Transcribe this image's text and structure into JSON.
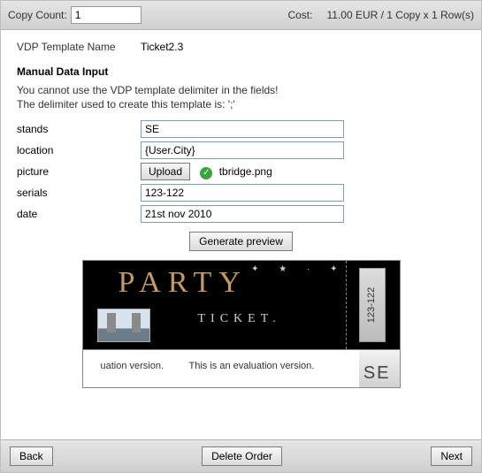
{
  "topbar": {
    "copy_label": "Copy Count:",
    "copy_value": "1",
    "cost_label": "Cost:",
    "cost_value": "11.00 EUR / 1 Copy x 1 Row(s)"
  },
  "template": {
    "name_label": "VDP Template Name",
    "name_value": "Ticket2.3"
  },
  "section_title": "Manual Data Input",
  "note_line1": "You cannot use the VDP template delimiter in the fields!",
  "note_line2": "The delimiter used to create this template is: ';'",
  "fields": {
    "stands": {
      "label": "stands",
      "value": "SE"
    },
    "location": {
      "label": "location",
      "value": "{User.City}"
    },
    "picture": {
      "label": "picture",
      "upload": "Upload",
      "file": "tbridge.png"
    },
    "serials": {
      "label": "serials",
      "value": "123-122"
    },
    "date": {
      "label": "date",
      "value": "21st nov 2010"
    }
  },
  "generate": "Generate preview",
  "preview": {
    "party": "PARTY",
    "ticket": "TICKET.",
    "serial": "123-122",
    "eval1": "uation version.",
    "eval2": "This is an evaluation version.",
    "se": "SE"
  },
  "footer": {
    "back": "Back",
    "delete": "Delete Order",
    "next": "Next"
  }
}
